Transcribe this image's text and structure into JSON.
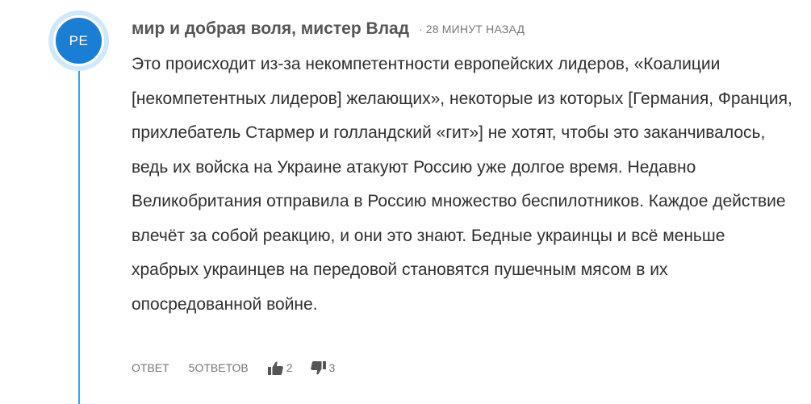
{
  "comment": {
    "avatar_initials": "PE",
    "author": "мир и добрая воля, мистер Влад",
    "separator": "·",
    "timestamp": "28 МИНУТ НАЗАД",
    "text": "Это происходит из-за некомпетентности европейских лидеров, «Коалиции [некомпетентных лидеров] желающих», некоторые из которых [Германия, Франция, прихлебатель Стармер и голландский «гит»] не хотят, чтобы это заканчивалось, ведь их войска на Украине атакуют Россию уже долгое время. Недавно Великобритания отправила в Россию множество беспилотников. Каждое действие влечёт за собой реакцию, и они это знают. Бедные украинцы и всё меньше храбрых украинцев на передовой становятся пушечным мясом в их опосредованной войне.",
    "actions": {
      "reply_label": "ОТВЕТ",
      "replies_label": "5ОТВЕТОВ",
      "upvotes": "2",
      "downvotes": "3"
    }
  },
  "colors": {
    "thread_line": "#3aa0e8",
    "avatar_bg": "#1a7fd4",
    "avatar_ring": "#cfe8fb",
    "text": "#2f2f2f",
    "meta": "#777777"
  },
  "icons": {
    "upvote": "thumbs-up-icon",
    "downvote": "thumbs-down-icon"
  }
}
